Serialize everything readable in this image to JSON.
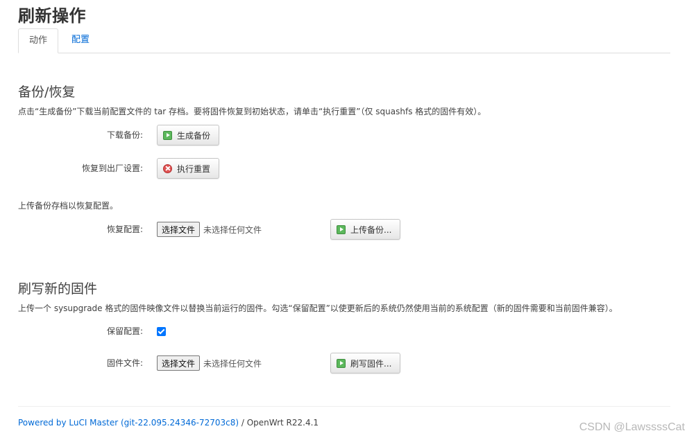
{
  "page": {
    "title": "刷新操作"
  },
  "tabs": [
    {
      "label": "动作",
      "active": true
    },
    {
      "label": "配置",
      "active": false
    }
  ],
  "backup": {
    "title": "备份/恢复",
    "description": "点击“生成备份”下载当前配置文件的 tar 存档。要将固件恢复到初始状态，请单击“执行重置”（仅 squashfs 格式的固件有效）。",
    "download_label": "下载备份:",
    "download_button": "生成备份",
    "reset_label": "恢复到出厂设置:",
    "reset_button": "执行重置",
    "upload_description": "上传备份存档以恢复配置。",
    "restore_label": "恢复配置:",
    "choose_file": "选择文件",
    "no_file": "未选择任何文件",
    "upload_button": "上传备份..."
  },
  "flash": {
    "title": "刷写新的固件",
    "description": "上传一个 sysupgrade 格式的固件映像文件以替换当前运行的固件。勾选“保留配置”以使更新后的系统仍然使用当前的系统配置（新的固件需要和当前固件兼容）。",
    "keep_label": "保留配置:",
    "keep_checked": true,
    "image_label": "固件文件:",
    "choose_file": "选择文件",
    "no_file": "未选择任何文件",
    "flash_button": "刷写固件..."
  },
  "footer": {
    "link_text": "Powered by LuCI Master (git-22.095.24346-72703c8)",
    "version_text": " / OpenWrt R22.4.1"
  },
  "watermark": "CSDN @Lawssss­Cat",
  "colors": {
    "link": "#0069d6",
    "checkbox": "#0075ff",
    "green_icon": "#5cb85c",
    "red_icon": "#e05252"
  }
}
